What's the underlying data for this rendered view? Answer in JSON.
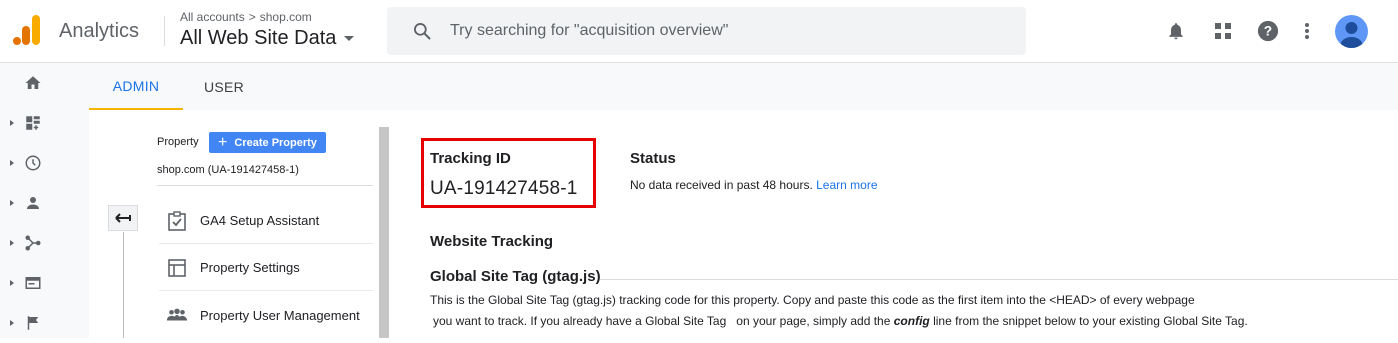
{
  "header": {
    "app_name": "Analytics",
    "breadcrumb": {
      "account": "All accounts",
      "separator": ">",
      "property": "shop.com"
    },
    "view_name": "All Web Site Data",
    "search_placeholder": "Try searching for \"acquisition overview\"",
    "icons": [
      "notifications-icon",
      "apps-grid-icon",
      "help-icon",
      "more-vert-icon",
      "avatar"
    ]
  },
  "left_nav": {
    "items": [
      "home-icon",
      "customization-icon",
      "realtime-icon",
      "audience-icon",
      "acquisition-icon",
      "behavior-icon",
      "conversions-icon"
    ]
  },
  "tabs": [
    {
      "label": "ADMIN",
      "active": true
    },
    {
      "label": "USER",
      "active": false
    }
  ],
  "property_panel": {
    "label": "Property",
    "create_button": "Create Property",
    "selected_property": "shop.com (UA-191427458-1)",
    "menu": [
      {
        "label": "GA4 Setup Assistant",
        "icon": "checklist-icon"
      },
      {
        "label": "Property Settings",
        "icon": "layout-icon"
      },
      {
        "label": "Property User Management",
        "icon": "people-icon"
      }
    ]
  },
  "tracking": {
    "id_label": "Tracking ID",
    "id_value": "UA-191427458-1",
    "status_label": "Status",
    "status_text": "No data received in past 48 hours.",
    "learn_more": "Learn more",
    "website_tracking_heading": "Website Tracking",
    "gtag_heading": "Global Site Tag (gtag.js)",
    "desc_line1": "This is the Global Site Tag (gtag.js) tracking code for this property. Copy and paste this code as the first item into the <HEAD> of every webpage",
    "desc_line2_a": "you want to track. If you already have a Global Site Tag",
    "desc_line2_b": "on your page, simply add the",
    "desc_line2_config": "config",
    "desc_line2_c": "line from the snippet below to your existing Global Site Tag."
  },
  "colors": {
    "brand_blue": "#1a73e8",
    "button_blue": "#4285f4",
    "tab_underline": "#f4b400",
    "highlight_red": "#e60000",
    "logo_orange": "#f9ab00",
    "logo_dark_orange": "#e37400"
  }
}
